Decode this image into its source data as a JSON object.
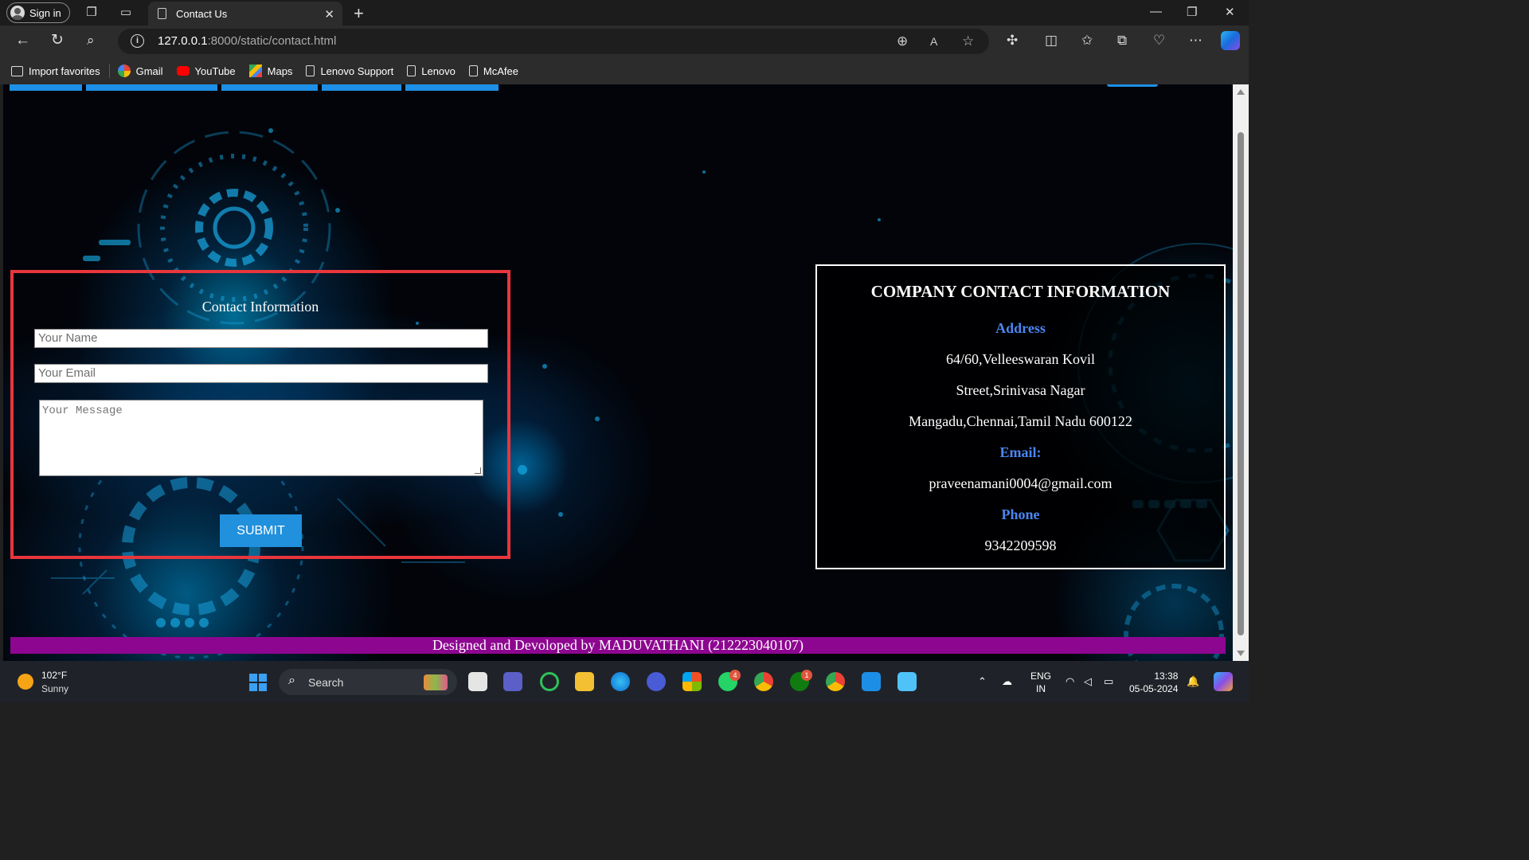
{
  "browser": {
    "signin_label": "Sign in",
    "tab_title": "Contact Us",
    "url_host": "127.0.0.1",
    "url_path": ":8000/static/contact.html"
  },
  "bookmarks": [
    {
      "label": "Import favorites",
      "icon": "import-icon"
    },
    {
      "label": "Gmail",
      "icon": "google-icon"
    },
    {
      "label": "YouTube",
      "icon": "youtube-icon"
    },
    {
      "label": "Maps",
      "icon": "maps-icon"
    },
    {
      "label": "Lenovo Support",
      "icon": "page-icon"
    },
    {
      "label": "Lenovo",
      "icon": "page-icon"
    },
    {
      "label": "McAfee",
      "icon": "page-icon"
    }
  ],
  "form": {
    "title": "Contact Information",
    "name_placeholder": "Your Name",
    "email_placeholder": "Your Email",
    "message_placeholder": "Your Message",
    "submit_label": "SUBMIT"
  },
  "company": {
    "title": "COMPANY CONTACT INFORMATION",
    "address_heading": "Address",
    "address_line1": "64/60,Velleeswaran Kovil",
    "address_line2": "Street,Srinivasa Nagar",
    "address_line3": "Mangadu,Chennai,Tamil Nadu 600122",
    "email_heading": "Email:",
    "email": "praveenamani0004@gmail.com",
    "phone_heading": "Phone",
    "phone": "9342209598"
  },
  "footer": {
    "text": "Designed and Devoloped by MADUVATHANI (212223040107)"
  },
  "taskbar": {
    "temperature": "102°F",
    "weather": "Sunny",
    "search_label": "Search",
    "whatsapp_badge": "4",
    "xbox_badge": "1",
    "lang_line1": "ENG",
    "lang_line2": "IN",
    "time": "13:38",
    "date": "05-05-2024"
  },
  "colors": {
    "form_border": "#e8363c",
    "submit_bg": "#2190dd",
    "heading_blue": "#4a86ef",
    "footer_bg": "#8d0690",
    "nav_blue": "#1e8fe6"
  }
}
